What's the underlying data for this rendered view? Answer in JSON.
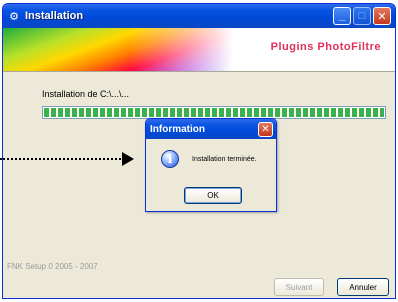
{
  "window": {
    "title": "Installation",
    "minimize_glyph": "_",
    "maximize_glyph": "□",
    "close_glyph": "✕",
    "title_icon": "install-icon"
  },
  "banner": {
    "title": "Plugins PhotoFiltre"
  },
  "main": {
    "install_label": "Installation de C:\\...\\...",
    "progress_percent": 100,
    "footer_text": "FNK Setup 0 2005 - 2007",
    "next_button": "Suivant",
    "cancel_button": "Annuler"
  },
  "dialog": {
    "title": "Information",
    "close_glyph": "✕",
    "icon": "info-icon",
    "icon_glyph": "i",
    "message": "Installation terminée.",
    "ok_button": "OK"
  },
  "colors": {
    "titlebar": "#0a54e4",
    "window_bg": "#ece9d8",
    "banner_title": "#e0305a",
    "progress": "#3ab14a"
  }
}
